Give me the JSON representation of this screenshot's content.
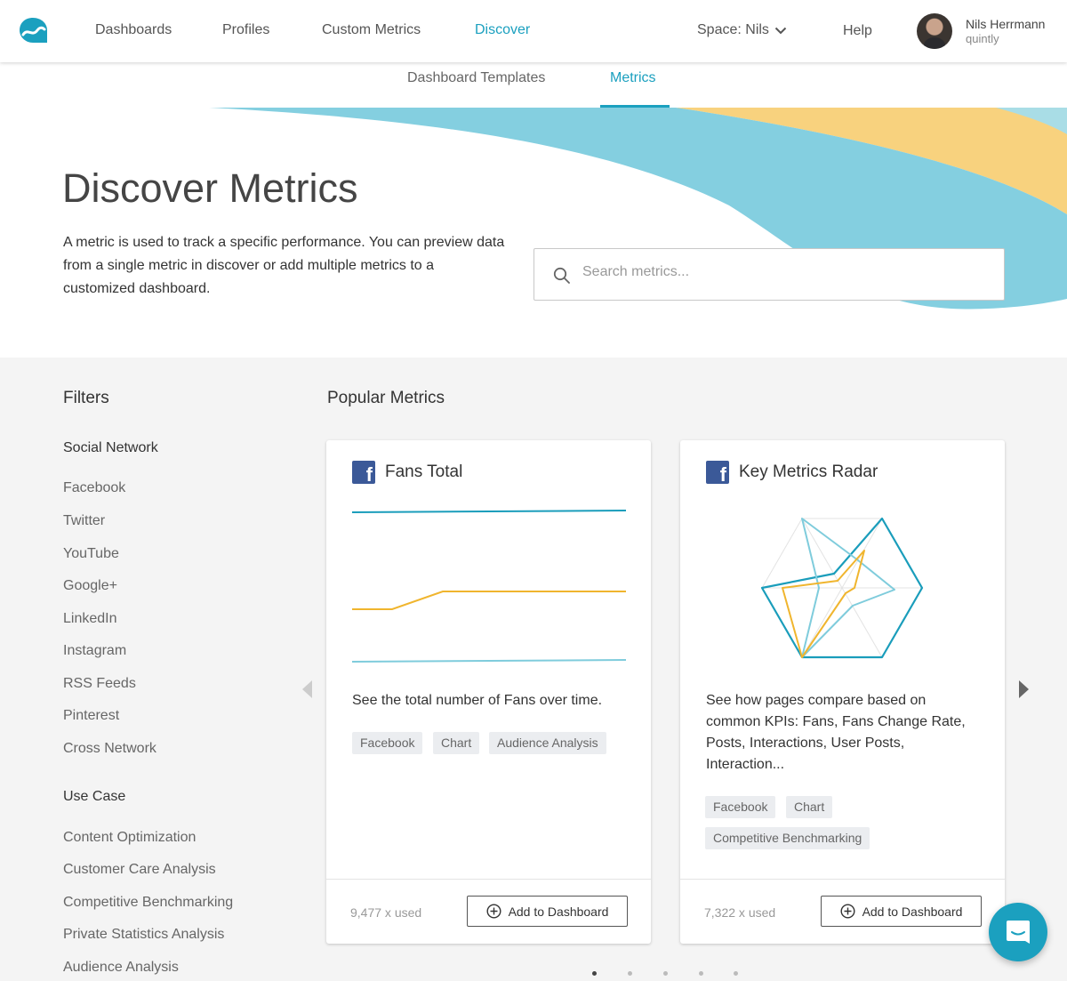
{
  "nav": {
    "items": [
      "Dashboards",
      "Profiles",
      "Custom Metrics",
      "Discover"
    ],
    "active": "Discover",
    "space_label": "Space: Nils",
    "help_label": "Help",
    "user_name": "Nils Herrmann",
    "user_org": "quintly"
  },
  "subtabs": {
    "items": [
      "Dashboard Templates",
      "Metrics"
    ],
    "active": "Metrics"
  },
  "hero": {
    "title": "Discover Metrics",
    "description": "A metric is used to track a specific performance. You can preview data from a single metric in discover or add multiple metrics to a customized dashboard.",
    "search_placeholder": "Search metrics..."
  },
  "filters": {
    "title": "Filters",
    "groups": [
      {
        "label": "Social Network",
        "items": [
          "Facebook",
          "Twitter",
          "YouTube",
          "Google+",
          "LinkedIn",
          "Instagram",
          "RSS Feeds",
          "Pinterest",
          "Cross Network"
        ]
      },
      {
        "label": "Use Case",
        "items": [
          "Content Optimization",
          "Customer Care Analysis",
          "Competitive Benchmarking",
          "Private Statistics Analysis",
          "Audience Analysis"
        ]
      }
    ]
  },
  "popular": {
    "title": "Popular Metrics",
    "cards": [
      {
        "title": "Fans Total",
        "network_icon": "facebook-icon",
        "description": "See the total number of Fans over time.",
        "tags": [
          "Facebook",
          "Chart",
          "Audience Analysis"
        ],
        "used": "9,477 x used",
        "button_label": "Add to Dashboard"
      },
      {
        "title": "Key Metrics Radar",
        "network_icon": "facebook-icon",
        "description": "See how pages compare based on common KPIs: Fans, Fans Change Rate, Posts, Interactions, User Posts, Interaction...",
        "tags": [
          "Facebook",
          "Chart",
          "Competitive Benchmarking"
        ],
        "used": "7,322 x used",
        "button_label": "Add to Dashboard"
      }
    ],
    "pagination": {
      "pages": 5,
      "current": 1
    }
  },
  "colors": {
    "accent": "#1ba0bf",
    "line_dark": "#1a9dbb",
    "line_orange": "#f0b52e",
    "line_light": "#7fccdc",
    "wave_blue": "#84cfe0",
    "wave_yellow": "#f8d27e",
    "facebook": "#3b5998"
  },
  "icons": {
    "logo": "quintly-logo",
    "space_dropdown": "chevron-down-icon",
    "search": "search-icon",
    "add": "plus-circle-icon",
    "chat": "chat-icon",
    "prev": "arrow-left-icon",
    "next": "arrow-right-icon"
  }
}
